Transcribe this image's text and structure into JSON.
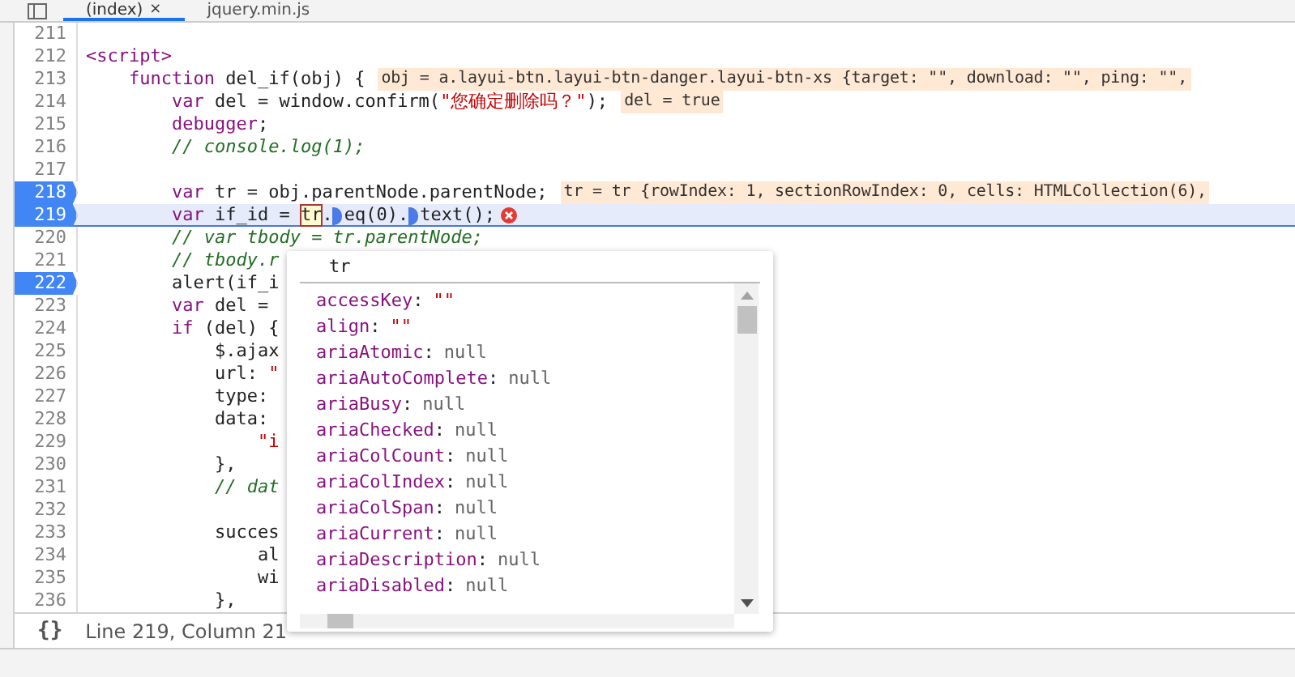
{
  "tabs": [
    {
      "label": "(index)",
      "close": "×",
      "selected": true
    },
    {
      "label": "jquery.min.js",
      "selected": false
    }
  ],
  "lines": [
    {
      "num": "211"
    },
    {
      "num": "212",
      "segs": [
        {
          "t": "<script>",
          "kind": "tag"
        }
      ]
    },
    {
      "num": "213",
      "segs": [
        {
          "t": "    function",
          "kind": "kw"
        },
        {
          "t": " del_if(obj) {",
          "kind": "plain"
        }
      ],
      "inline": "obj = a.layui-btn.layui-btn-danger.layui-btn-xs {target: \"\", download: \"\", ping: \"\","
    },
    {
      "num": "214",
      "segs": [
        {
          "t": "        var",
          "kind": "kw"
        },
        {
          "t": " del = window.confirm(",
          "kind": "plain"
        },
        {
          "t": "\"您确定删除吗？\"",
          "kind": "str"
        },
        {
          "t": ");",
          "kind": "plain"
        }
      ],
      "inline": "del = true"
    },
    {
      "num": "215",
      "segs": [
        {
          "t": "        debugger",
          "kind": "kw"
        },
        {
          "t": ";",
          "kind": "plain"
        }
      ]
    },
    {
      "num": "216",
      "segs": [
        {
          "t": "        // console.log(1);",
          "kind": "comment"
        }
      ]
    },
    {
      "num": "217"
    },
    {
      "num": "218",
      "breakpoint": true,
      "segs": [
        {
          "t": "        var",
          "kind": "kw"
        },
        {
          "t": " tr = obj.parentNode.parentNode;",
          "kind": "plain"
        }
      ],
      "inline": "tr = tr {rowIndex: 1, sectionRowIndex: 0, cells: HTMLCollection(6),"
    },
    {
      "num": "219",
      "breakpoint": true,
      "current": true,
      "error": true,
      "segs": [
        {
          "t": "        var",
          "kind": "kw"
        },
        {
          "t": " if_id = ",
          "kind": "plain"
        },
        {
          "t": "tr",
          "kind": "hover"
        },
        {
          "t": ".",
          "kind": "plain"
        },
        {
          "kind": "marker"
        },
        {
          "t": "eq(0).",
          "kind": "plain"
        },
        {
          "kind": "marker"
        },
        {
          "t": "text();",
          "kind": "plain"
        }
      ]
    },
    {
      "num": "220",
      "segs": [
        {
          "t": "        // var tbody = tr.parentNode;",
          "kind": "comment"
        }
      ]
    },
    {
      "num": "221",
      "segs": [
        {
          "t": "        // tbody.r",
          "kind": "comment"
        }
      ]
    },
    {
      "num": "222",
      "breakpoint": true,
      "segs": [
        {
          "t": "        alert(if_i",
          "kind": "plain"
        }
      ]
    },
    {
      "num": "223",
      "segs": [
        {
          "t": "        var",
          "kind": "kw"
        },
        {
          "t": " del =",
          "kind": "plain"
        }
      ]
    },
    {
      "num": "224",
      "segs": [
        {
          "t": "        if",
          "kind": "kw"
        },
        {
          "t": " (del) {",
          "kind": "plain"
        }
      ]
    },
    {
      "num": "225",
      "segs": [
        {
          "t": "            $.ajax",
          "kind": "plain"
        }
      ]
    },
    {
      "num": "226",
      "segs": [
        {
          "t": "            url: ",
          "kind": "plain"
        },
        {
          "t": "\"",
          "kind": "str"
        }
      ]
    },
    {
      "num": "227",
      "segs": [
        {
          "t": "            type:",
          "kind": "plain"
        }
      ]
    },
    {
      "num": "228",
      "segs": [
        {
          "t": "            data:",
          "kind": "plain"
        }
      ]
    },
    {
      "num": "229",
      "segs": [
        {
          "t": "                \"i",
          "kind": "str"
        }
      ]
    },
    {
      "num": "230",
      "segs": [
        {
          "t": "            },",
          "kind": "plain"
        }
      ]
    },
    {
      "num": "231",
      "segs": [
        {
          "t": "            // dat",
          "kind": "comment"
        }
      ]
    },
    {
      "num": "232"
    },
    {
      "num": "233",
      "segs": [
        {
          "t": "            succes",
          "kind": "plain"
        }
      ]
    },
    {
      "num": "234",
      "segs": [
        {
          "t": "                al",
          "kind": "plain"
        }
      ]
    },
    {
      "num": "235",
      "segs": [
        {
          "t": "                wi",
          "kind": "plain"
        }
      ]
    },
    {
      "num": "236",
      "segs": [
        {
          "t": "            },",
          "kind": "plain"
        }
      ]
    }
  ],
  "popover": {
    "title": "tr",
    "props": [
      {
        "name": "accessKey",
        "colon": ":",
        "value": "\"\"",
        "kind": "string"
      },
      {
        "name": "align",
        "colon": ":",
        "value": "\"\"",
        "kind": "string"
      },
      {
        "name": "ariaAtomic",
        "colon": ":",
        "value": "null",
        "kind": "null"
      },
      {
        "name": "ariaAutoComplete",
        "colon": ":",
        "value": "null",
        "kind": "null"
      },
      {
        "name": "ariaBusy",
        "colon": ":",
        "value": "null",
        "kind": "null"
      },
      {
        "name": "ariaChecked",
        "colon": ":",
        "value": "null",
        "kind": "null"
      },
      {
        "name": "ariaColCount",
        "colon": ":",
        "value": "null",
        "kind": "null"
      },
      {
        "name": "ariaColIndex",
        "colon": ":",
        "value": "null",
        "kind": "null"
      },
      {
        "name": "ariaColSpan",
        "colon": ":",
        "value": "null",
        "kind": "null"
      },
      {
        "name": "ariaCurrent",
        "colon": ":",
        "value": "null",
        "kind": "null"
      },
      {
        "name": "ariaDescription",
        "colon": ":",
        "value": "null",
        "kind": "null"
      },
      {
        "name": "ariaDisabled",
        "colon": ":",
        "value": "null",
        "kind": "null"
      }
    ]
  },
  "status_bar": {
    "format_button": "{}",
    "position": "Line 219, Column 21"
  }
}
